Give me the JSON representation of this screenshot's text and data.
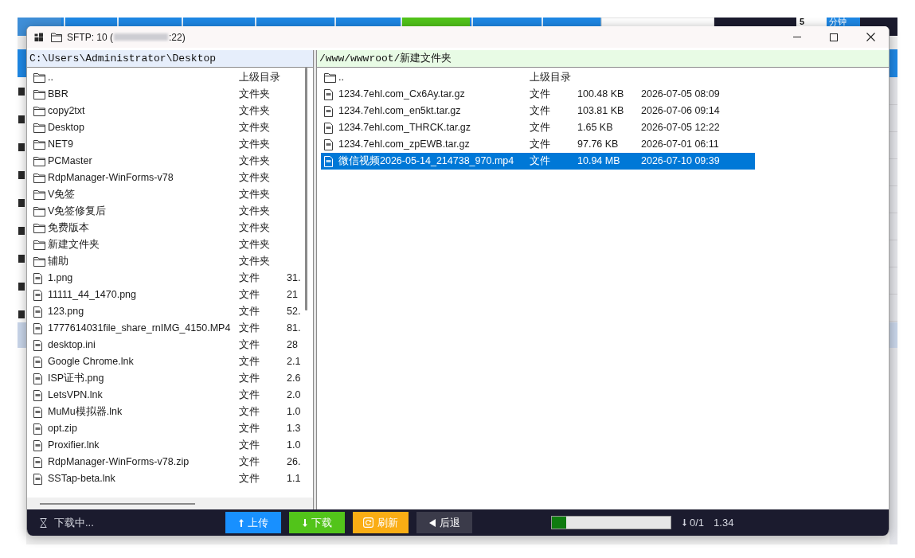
{
  "background_window": {
    "toolbar_texts": [
      "5",
      "分钟"
    ]
  },
  "dialog": {
    "title_start": "SFTP: 10 (",
    "title_end": ":22)"
  },
  "local_pane": {
    "path": "C:\\Users\\Administrator\\Desktop",
    "rows": [
      {
        "kind": "folder",
        "name": "..",
        "type": "上级目录",
        "selected": false
      },
      {
        "kind": "folder",
        "name": "BBR",
        "type": "文件夹",
        "selected": false
      },
      {
        "kind": "folder",
        "name": "copy2txt",
        "type": "文件夹",
        "selected": false
      },
      {
        "kind": "folder",
        "name": "Desktop",
        "type": "文件夹",
        "selected": false
      },
      {
        "kind": "folder",
        "name": "NET9",
        "type": "文件夹",
        "selected": false
      },
      {
        "kind": "folder",
        "name": "PCMaster",
        "type": "文件夹",
        "selected": false
      },
      {
        "kind": "folder",
        "name": "RdpManager-WinForms-v78",
        "type": "文件夹",
        "selected": false
      },
      {
        "kind": "folder",
        "name": "V免签",
        "type": "文件夹",
        "selected": false
      },
      {
        "kind": "folder",
        "name": "V免签修复后",
        "type": "文件夹",
        "selected": false
      },
      {
        "kind": "folder",
        "name": "免费版本",
        "type": "文件夹",
        "selected": false
      },
      {
        "kind": "folder",
        "name": "新建文件夹",
        "type": "文件夹",
        "selected": false
      },
      {
        "kind": "folder",
        "name": "辅助",
        "type": "文件夹",
        "selected": false
      },
      {
        "kind": "file",
        "name": "1.png",
        "type": "文件",
        "size": "31.",
        "selected": false
      },
      {
        "kind": "file",
        "name": "11111_44_1470.png",
        "type": "文件",
        "size": "21",
        "selected": false
      },
      {
        "kind": "file",
        "name": "123.png",
        "type": "文件",
        "size": "52.",
        "selected": false
      },
      {
        "kind": "file",
        "name": "1777614031file_share_rnIMG_4150.MP4",
        "type": "文件",
        "size": "81.",
        "selected": false
      },
      {
        "kind": "file",
        "name": "desktop.ini",
        "type": "文件",
        "size": "28",
        "selected": false
      },
      {
        "kind": "file",
        "name": "Google Chrome.lnk",
        "type": "文件",
        "size": "2.1",
        "selected": false
      },
      {
        "kind": "file",
        "name": "ISP证书.png",
        "type": "文件",
        "size": "2.6",
        "selected": false
      },
      {
        "kind": "file",
        "name": "LetsVPN.lnk",
        "type": "文件",
        "size": "2.0",
        "selected": false
      },
      {
        "kind": "file",
        "name": "MuMu模拟器.lnk",
        "type": "文件",
        "size": "1.0",
        "selected": false
      },
      {
        "kind": "file",
        "name": "opt.zip",
        "type": "文件",
        "size": "1.3",
        "selected": false
      },
      {
        "kind": "file",
        "name": "Proxifier.lnk",
        "type": "文件",
        "size": "1.0",
        "selected": false
      },
      {
        "kind": "file",
        "name": "RdpManager-WinForms-v78.zip",
        "type": "文件",
        "size": "26.",
        "selected": false
      },
      {
        "kind": "file",
        "name": "SSTap-beta.lnk",
        "type": "文件",
        "size": "1.1",
        "selected": false
      }
    ]
  },
  "remote_pane": {
    "path": "/www/wwwroot/新建文件夹",
    "rows": [
      {
        "kind": "folder",
        "name": "..",
        "type": "上级目录",
        "selected": false
      },
      {
        "kind": "file",
        "name": "1234.7ehl.com_Cx6Ay.tar.gz",
        "type": "文件",
        "size": "100.48 KB",
        "date": "2026-07-05 08:09",
        "selected": false
      },
      {
        "kind": "file",
        "name": "1234.7ehl.com_en5kt.tar.gz",
        "type": "文件",
        "size": "103.81 KB",
        "date": "2026-07-06 09:14",
        "selected": false
      },
      {
        "kind": "file",
        "name": "1234.7ehl.com_THRCK.tar.gz",
        "type": "文件",
        "size": "1.65 KB",
        "date": "2026-07-05 12:22",
        "selected": false
      },
      {
        "kind": "file",
        "name": "1234.7ehl.com_zpEWB.tar.gz",
        "type": "文件",
        "size": "97.76 KB",
        "date": "2026-07-01 06:11",
        "selected": false
      },
      {
        "kind": "file",
        "name": "微信视频2026-05-14_214738_970.mp4",
        "type": "文件",
        "size": "10.94 MB",
        "date": "2026-07-10 09:39",
        "selected": true
      }
    ]
  },
  "status_bar": {
    "status": "下载中...",
    "buttons": [
      {
        "kind": "upload",
        "label": "上传"
      },
      {
        "kind": "download",
        "label": "下载"
      },
      {
        "kind": "refresh",
        "label": "刷新"
      },
      {
        "kind": "back",
        "label": "后退"
      }
    ],
    "progress": {
      "level": 0.12
    },
    "transfer_count": "0/1",
    "speed": "1.34"
  }
}
